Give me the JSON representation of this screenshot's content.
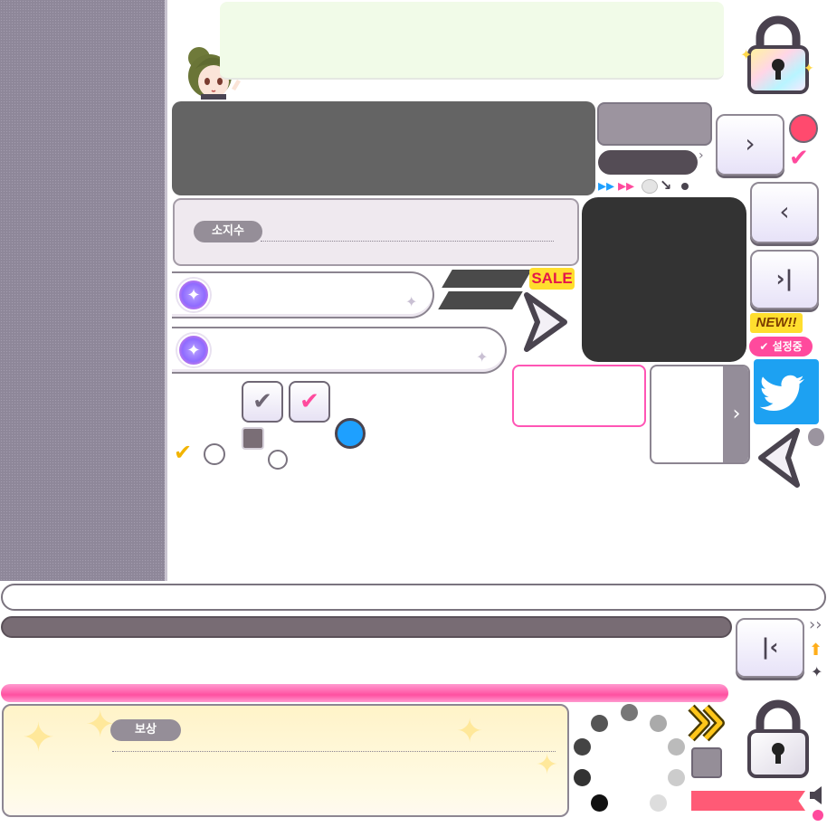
{
  "owned": {
    "label": "소지수"
  },
  "reward": {
    "label": "보상"
  },
  "sale_badge": "SALE",
  "new_badge": "NEW!!",
  "active_badge": "설정중",
  "glyphs": {
    "next": "›",
    "prev": "‹",
    "last": "›|",
    "first": "|‹",
    "check": "✔",
    "sparkle": "✦",
    "arrow_up": "⬆",
    "fast_forward": "»",
    "chevron_right": "❯"
  },
  "colors": {
    "accent_pink": "#ff4a9d",
    "twitter_blue": "#1da1f2",
    "sale_yellow": "#ffde2e",
    "indicator_blue": "#1ea0ff",
    "indicator_red": "#ff4a6e"
  },
  "icons": [
    "character-avatar",
    "lock-icon",
    "twitter-icon",
    "check-icon",
    "sparkle-icon",
    "speaker-icon",
    "fast-forward-icon"
  ]
}
